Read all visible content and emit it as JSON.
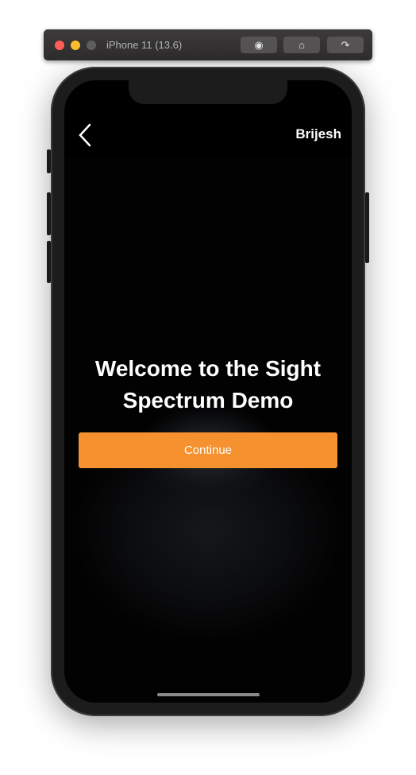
{
  "simulator": {
    "title": "iPhone 11 (13.6)",
    "buttons": [
      "screenshot-icon",
      "home-icon",
      "rotate-icon"
    ],
    "colors": {
      "close": "#fe5f57",
      "minimize": "#febc2e",
      "zoom": "#5f5f5f"
    }
  },
  "app": {
    "username": "Brijesh",
    "title_line1": "Welcome to the Sight",
    "title_line2": "Spectrum Demo",
    "continue_label": "Continue",
    "accent": "#f5912e"
  }
}
